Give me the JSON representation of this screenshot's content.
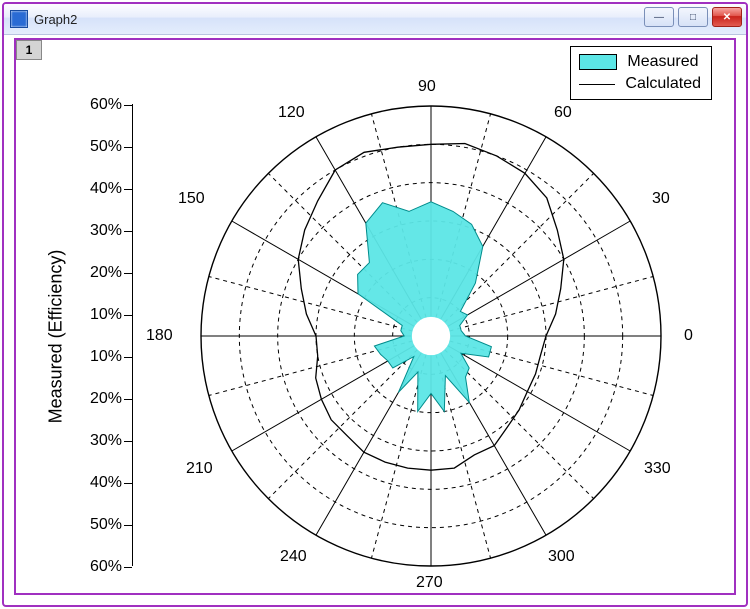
{
  "window": {
    "title": "Graph2",
    "tab_label": "1"
  },
  "win_buttons": {
    "min": "—",
    "max": "□",
    "close": "✕"
  },
  "legend": {
    "measured": "Measured",
    "calculated": "Calculated"
  },
  "yaxis": {
    "label": "Measured (Efficiency)",
    "ticks": [
      "60%",
      "50%",
      "40%",
      "30%",
      "20%",
      "10%",
      "10%",
      "20%",
      "30%",
      "40%",
      "50%",
      "60%"
    ]
  },
  "angles": {
    "a0": "0",
    "a30": "30",
    "a60": "60",
    "a90": "90",
    "a120": "120",
    "a150": "150",
    "a180": "180",
    "a210": "210",
    "a240": "240",
    "a270": "270",
    "a300": "300",
    "a330": "330"
  },
  "chart_data": {
    "type": "polar",
    "angle_unit": "degrees",
    "radial_label": "Measured (Efficiency)",
    "radial_ticks_percent": [
      10,
      20,
      30,
      40,
      50,
      60
    ],
    "radial_range_percent": [
      0,
      60
    ],
    "angle_ticks_deg": [
      0,
      30,
      60,
      90,
      120,
      150,
      180,
      210,
      240,
      270,
      300,
      330
    ],
    "series": [
      {
        "name": "Measured",
        "style": "filled",
        "color": "#5ce6e6",
        "angles_deg": [
          0,
          10,
          20,
          30,
          40,
          50,
          60,
          70,
          80,
          90,
          100,
          110,
          120,
          130,
          140,
          150,
          160,
          170,
          180,
          190,
          200,
          210,
          220,
          230,
          240,
          250,
          260,
          270,
          280,
          290,
          300,
          310,
          320,
          330,
          340,
          350
        ],
        "values_percent": [
          9,
          8,
          8,
          11,
          10,
          18,
          27,
          31,
          33,
          35,
          33,
          37,
          34,
          25,
          25,
          22,
          8,
          8,
          7,
          15,
          14,
          13,
          13,
          7,
          17,
          10,
          20,
          15,
          20,
          11,
          20,
          14,
          13,
          9,
          16,
          16
        ]
      },
      {
        "name": "Calculated",
        "style": "line",
        "color": "#000000",
        "angles_deg": [
          0,
          10,
          20,
          30,
          40,
          50,
          60,
          70,
          80,
          90,
          100,
          110,
          120,
          130,
          140,
          150,
          160,
          170,
          180,
          190,
          200,
          210,
          220,
          230,
          240,
          250,
          260,
          270,
          280,
          290,
          300,
          310,
          320,
          330,
          340,
          350
        ],
        "values_percent": [
          30,
          33,
          36,
          40,
          43,
          47,
          49,
          50,
          51,
          50,
          50,
          51,
          50,
          46,
          43,
          40,
          36,
          33,
          30,
          30,
          32,
          33,
          34,
          34,
          35,
          35,
          35,
          35,
          35,
          33,
          33,
          31,
          30,
          29,
          29,
          29
        ]
      }
    ]
  }
}
